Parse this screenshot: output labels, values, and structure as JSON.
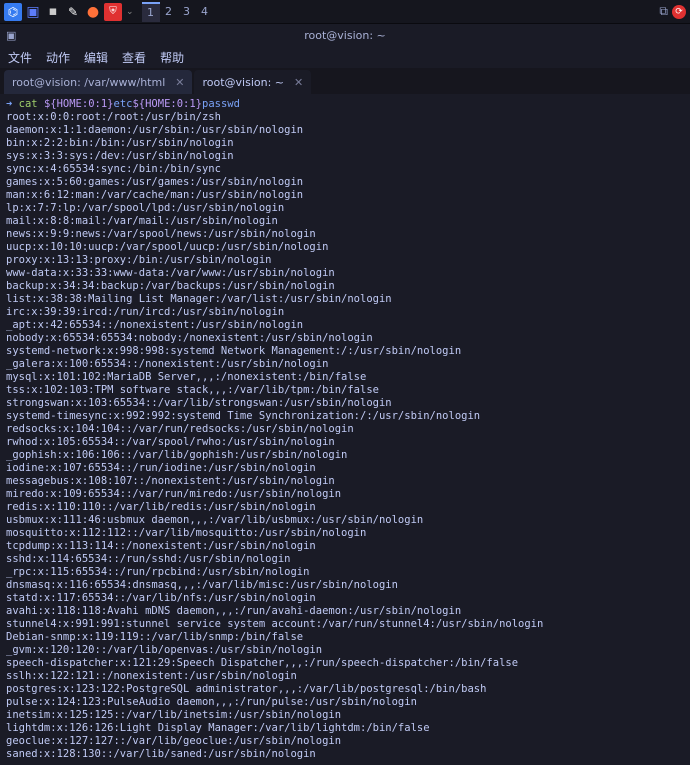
{
  "taskbar": {
    "workspaces": [
      "1",
      "2",
      "3",
      "4"
    ]
  },
  "window": {
    "title": "root@vision: ~"
  },
  "menubar": {
    "file": "文件",
    "actions": "动作",
    "edit": "编辑",
    "view": "查看",
    "help": "帮助"
  },
  "tabs": [
    {
      "label": "root@vision: /var/www/html",
      "active": false
    },
    {
      "label": "root@vision: ~",
      "active": true
    }
  ],
  "prompt": {
    "arrow": "➜",
    "cmd": "cat",
    "var1": "${HOME:0:1}",
    "mid": "etc",
    "var2": "${HOME:0:1}",
    "file": "passwd"
  },
  "output": [
    "root:x:0:0:root:/root:/usr/bin/zsh",
    "daemon:x:1:1:daemon:/usr/sbin:/usr/sbin/nologin",
    "bin:x:2:2:bin:/bin:/usr/sbin/nologin",
    "sys:x:3:3:sys:/dev:/usr/sbin/nologin",
    "sync:x:4:65534:sync:/bin:/bin/sync",
    "games:x:5:60:games:/usr/games:/usr/sbin/nologin",
    "man:x:6:12:man:/var/cache/man:/usr/sbin/nologin",
    "lp:x:7:7:lp:/var/spool/lpd:/usr/sbin/nologin",
    "mail:x:8:8:mail:/var/mail:/usr/sbin/nologin",
    "news:x:9:9:news:/var/spool/news:/usr/sbin/nologin",
    "uucp:x:10:10:uucp:/var/spool/uucp:/usr/sbin/nologin",
    "proxy:x:13:13:proxy:/bin:/usr/sbin/nologin",
    "www-data:x:33:33:www-data:/var/www:/usr/sbin/nologin",
    "backup:x:34:34:backup:/var/backups:/usr/sbin/nologin",
    "list:x:38:38:Mailing List Manager:/var/list:/usr/sbin/nologin",
    "irc:x:39:39:ircd:/run/ircd:/usr/sbin/nologin",
    "_apt:x:42:65534::/nonexistent:/usr/sbin/nologin",
    "nobody:x:65534:65534:nobody:/nonexistent:/usr/sbin/nologin",
    "systemd-network:x:998:998:systemd Network Management:/:/usr/sbin/nologin",
    "_galera:x:100:65534::/nonexistent:/usr/sbin/nologin",
    "mysql:x:101:102:MariaDB Server,,,:/nonexistent:/bin/false",
    "tss:x:102:103:TPM software stack,,,:/var/lib/tpm:/bin/false",
    "strongswan:x:103:65534::/var/lib/strongswan:/usr/sbin/nologin",
    "systemd-timesync:x:992:992:systemd Time Synchronization:/:/usr/sbin/nologin",
    "redsocks:x:104:104::/var/run/redsocks:/usr/sbin/nologin",
    "rwhod:x:105:65534::/var/spool/rwho:/usr/sbin/nologin",
    "_gophish:x:106:106::/var/lib/gophish:/usr/sbin/nologin",
    "iodine:x:107:65534::/run/iodine:/usr/sbin/nologin",
    "messagebus:x:108:107::/nonexistent:/usr/sbin/nologin",
    "miredo:x:109:65534::/var/run/miredo:/usr/sbin/nologin",
    "redis:x:110:110::/var/lib/redis:/usr/sbin/nologin",
    "usbmux:x:111:46:usbmux daemon,,,:/var/lib/usbmux:/usr/sbin/nologin",
    "mosquitto:x:112:112::/var/lib/mosquitto:/usr/sbin/nologin",
    "tcpdump:x:113:114::/nonexistent:/usr/sbin/nologin",
    "sshd:x:114:65534::/run/sshd:/usr/sbin/nologin",
    "_rpc:x:115:65534::/run/rpcbind:/usr/sbin/nologin",
    "dnsmasq:x:116:65534:dnsmasq,,,:/var/lib/misc:/usr/sbin/nologin",
    "statd:x:117:65534::/var/lib/nfs:/usr/sbin/nologin",
    "avahi:x:118:118:Avahi mDNS daemon,,,:/run/avahi-daemon:/usr/sbin/nologin",
    "stunnel4:x:991:991:stunnel service system account:/var/run/stunnel4:/usr/sbin/nologin",
    "Debian-snmp:x:119:119::/var/lib/snmp:/bin/false",
    "_gvm:x:120:120::/var/lib/openvas:/usr/sbin/nologin",
    "speech-dispatcher:x:121:29:Speech Dispatcher,,,:/run/speech-dispatcher:/bin/false",
    "sslh:x:122:121::/nonexistent:/usr/sbin/nologin",
    "postgres:x:123:122:PostgreSQL administrator,,,:/var/lib/postgresql:/bin/bash",
    "pulse:x:124:123:PulseAudio daemon,,,:/run/pulse:/usr/sbin/nologin",
    "inetsim:x:125:125::/var/lib/inetsim:/usr/sbin/nologin",
    "lightdm:x:126:126:Light Display Manager:/var/lib/lightdm:/bin/false",
    "geoclue:x:127:127::/var/lib/geoclue:/usr/sbin/nologin",
    "saned:x:128:130::/var/lib/saned:/usr/sbin/nologin"
  ]
}
